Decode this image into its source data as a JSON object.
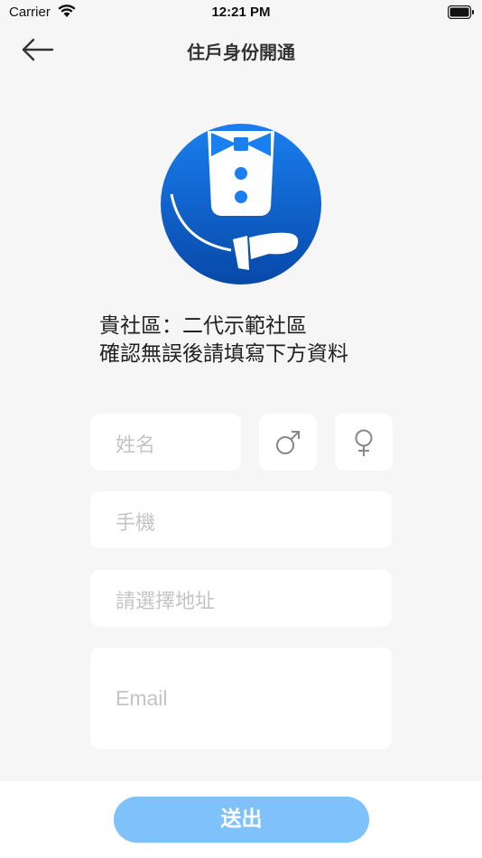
{
  "status_bar": {
    "carrier": "Carrier",
    "time": "12:21 PM"
  },
  "nav": {
    "title": "住戶身份開通",
    "back_icon": "arrow-left-icon"
  },
  "logo": {
    "icon": "butler-logo",
    "primary_color": "#0a66d8"
  },
  "community": {
    "line1": "貴社區：二代示範社區",
    "line2": "確認無誤後請填寫下方資料"
  },
  "form": {
    "name_placeholder": "姓名",
    "male_icon": "male-symbol-icon",
    "female_icon": "female-symbol-icon",
    "phone_placeholder": "手機",
    "address_placeholder": "請選擇地址",
    "email_placeholder": "Email"
  },
  "submit": {
    "label": "送出",
    "color": "#7fc1fb"
  }
}
